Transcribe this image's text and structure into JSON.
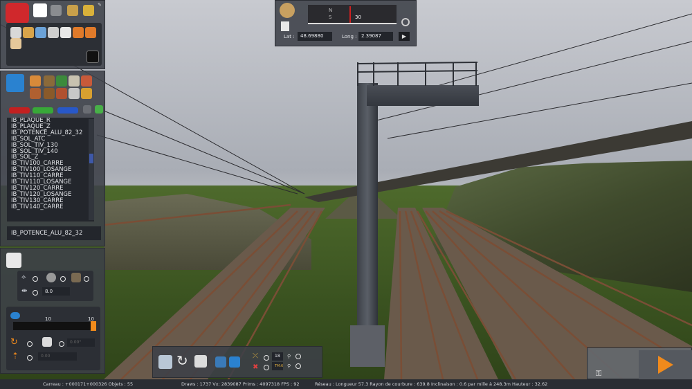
{
  "top_icons": [
    "toolbox-icon",
    "home-icon",
    "rails-icon",
    "brush-icon",
    "train-icon"
  ],
  "object_list": {
    "items": [
      "IB_PLAQUE_R",
      "IB_PLAQUE_Z",
      "IB_POTENCE_ALU_82_32",
      "IB_SOL_ATC",
      "IB_SOL_TIV_130",
      "IB_SOL_TIV_140",
      "IB_SOL_Z",
      "IB_TIV100_CARRE",
      "IB_TIV100_LOSANGE",
      "IB_TIV110_CARRE",
      "IB_TIV110_LOSANGE",
      "IB_TIV120_CARRE",
      "IB_TIV120_LOSANGE",
      "IB_TIV130_CARRE",
      "IB_TIV140_CARRE"
    ],
    "selected": "IB_POTENCE_ALU_82_32"
  },
  "properties": {
    "height_value": "8.0",
    "slider_min": "10",
    "slider_max": "10",
    "rotation_value": "0.00°",
    "offset_value": "0.00"
  },
  "compass": {
    "heading_n": "N",
    "heading_mark": "30",
    "heading_tick": "S",
    "lat_label": "Lat :",
    "lat_value": "48.69880",
    "long_label": "Long :",
    "long_value": "2.39087"
  },
  "bottom_toolbar": {
    "counter": "18",
    "timer": "TM:6"
  },
  "status": {
    "carreau": "Carreau : +000171+000326  Objets : 55",
    "draws": "Draws : 1737 Vx: 2839087 Prims : 4097318 FPS : 92",
    "reseau": "Réseau :  Longueur   57.3 Rayon de courbure : 639.8 Inclinaison :   0.6 par mille à 248.3m Hauteur :   32.62"
  },
  "colors": {
    "panel": "#3c4048",
    "accent_orange": "#f08a1c",
    "list_select": "#3e58a8"
  }
}
